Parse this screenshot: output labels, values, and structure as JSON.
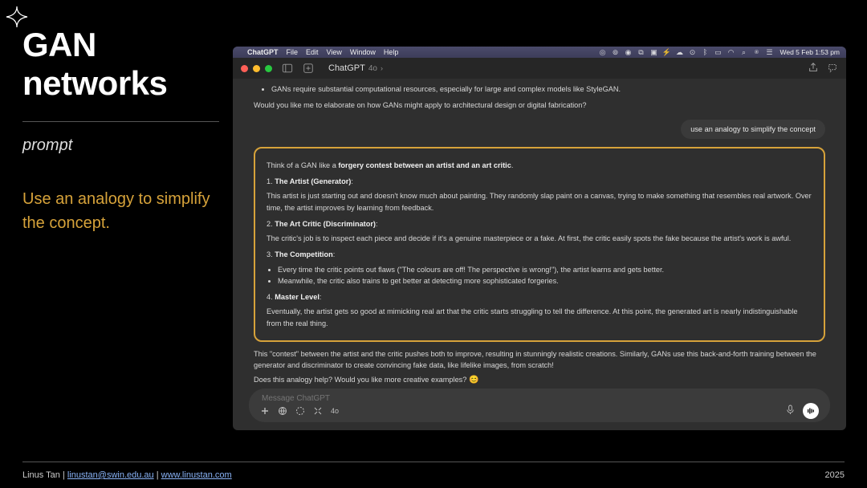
{
  "slide": {
    "title_line1": "GAN",
    "title_line2": "networks",
    "prompt_label": "prompt",
    "body": "Use an analogy to simplify the concept."
  },
  "footer": {
    "author": "Linus Tan",
    "email": "linustan@swin.edu.au",
    "site": "www.linustan.com",
    "sep": " | ",
    "year": "2025"
  },
  "menubar": {
    "app": "ChatGPT",
    "items": [
      "File",
      "Edit",
      "View",
      "Window",
      "Help"
    ],
    "clock": "Wed 5 Feb  1:53 pm"
  },
  "titlebar": {
    "title": "ChatGPT",
    "model": "4o",
    "chevron": "›"
  },
  "chat": {
    "prior_bullet": "GANs require substantial computational resources, especially for large and complex models like StyleGAN.",
    "prior_followup": "Would you like me to elaborate on how GANs might apply to architectural design or digital fabrication?",
    "user_prompt": "use an analogy to simplify the concept",
    "intro_a": "Think of a GAN like a ",
    "intro_b": "forgery contest between an artist and an art critic",
    "intro_c": ".",
    "items": [
      {
        "num": "1.",
        "head": "The Artist (Generator)",
        "colon": ":",
        "body": "This artist is just starting out and doesn't know much about painting. They randomly slap paint on a canvas, trying to make something that resembles real artwork. Over time, the artist improves by learning from feedback."
      },
      {
        "num": "2.",
        "head": "The Art Critic (Discriminator)",
        "colon": ":",
        "body": "The critic's job is to inspect each piece and decide if it's a genuine masterpiece or a fake. At first, the critic easily spots the fake because the artist's work is awful."
      },
      {
        "num": "3.",
        "head": "The Competition",
        "colon": ":",
        "bullets": [
          "Every time the critic points out flaws (\"The colours are off! The perspective is wrong!\"), the artist learns and gets better.",
          "Meanwhile, the critic also trains to get better at detecting more sophisticated forgeries."
        ]
      },
      {
        "num": "4.",
        "head": "Master Level",
        "colon": ":",
        "body": "Eventually, the artist gets so good at mimicking real art that the critic starts struggling to tell the difference. At this point, the generated art is nearly indistinguishable from the real thing."
      }
    ],
    "closing1": "This \"contest\" between the artist and the critic pushes both to improve, resulting in stunningly realistic creations. Similarly, GANs use this back-and-forth training between the generator and discriminator to create convincing fake data, like lifelike images, from scratch!",
    "closing2": "Does this analogy help? Would you like more creative examples? ",
    "emoji": "😊"
  },
  "composer": {
    "placeholder": "Message ChatGPT",
    "model": "4o"
  }
}
